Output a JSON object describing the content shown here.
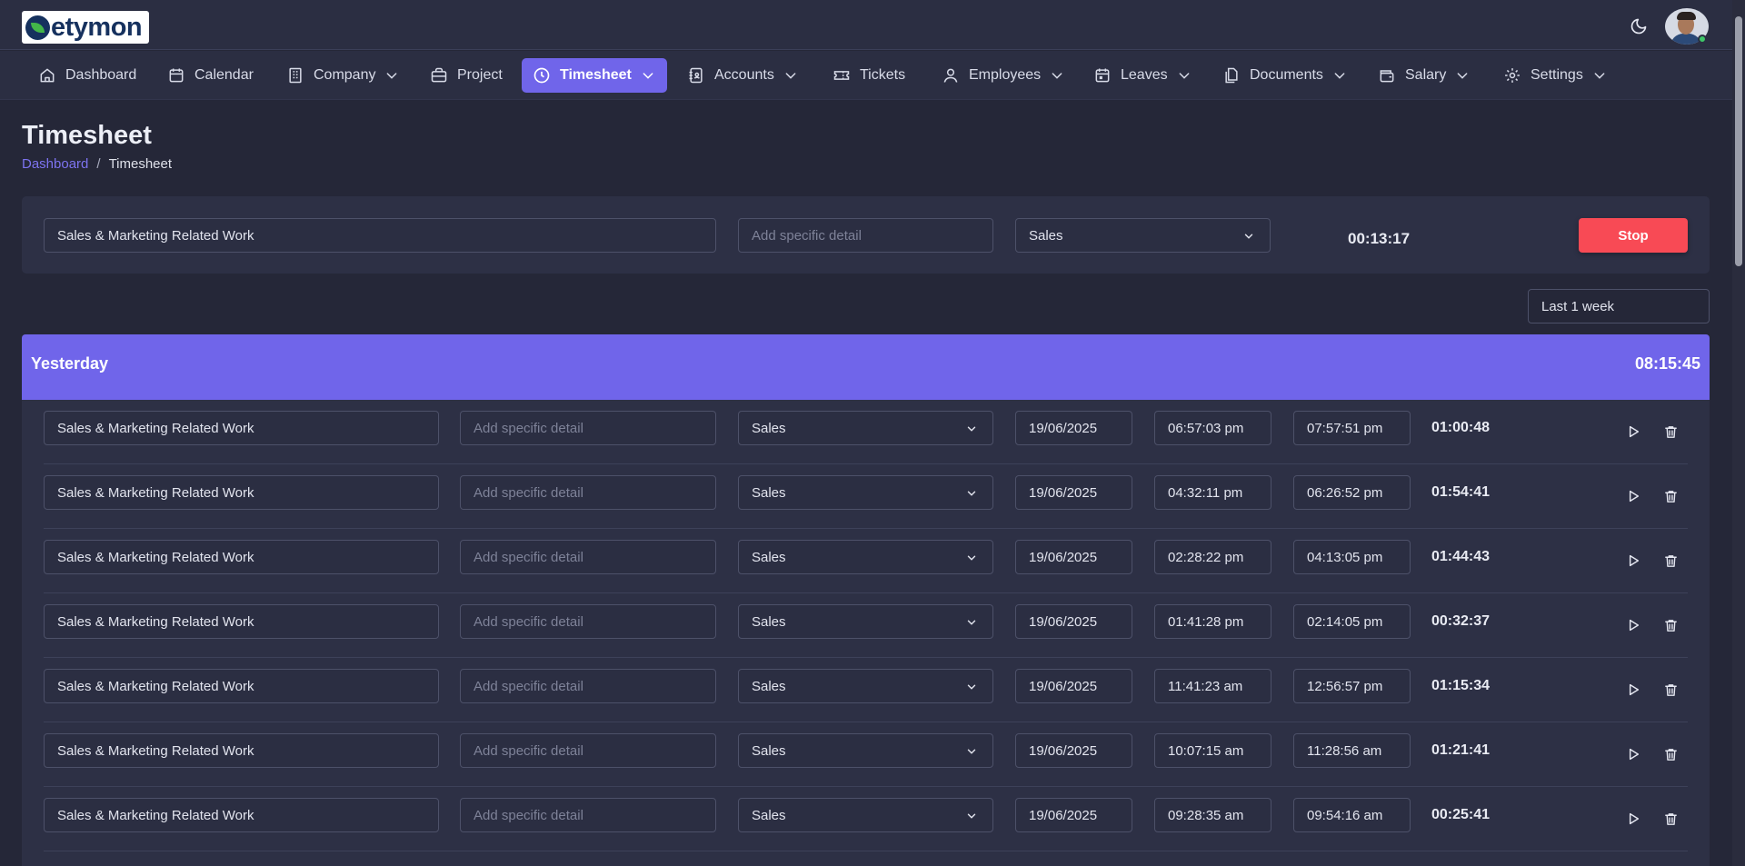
{
  "app": {
    "logo_text": "etymon"
  },
  "nav": {
    "items": [
      {
        "label": "Dashboard",
        "icon": "home-icon"
      },
      {
        "label": "Calendar",
        "icon": "calendar-icon"
      },
      {
        "label": "Company",
        "icon": "building-icon",
        "dropdown": true
      },
      {
        "label": "Project",
        "icon": "briefcase-icon"
      },
      {
        "label": "Timesheet",
        "icon": "clock-icon",
        "dropdown": true,
        "active": true
      },
      {
        "label": "Accounts",
        "icon": "ledger-icon",
        "dropdown": true
      },
      {
        "label": "Tickets",
        "icon": "ticket-icon"
      },
      {
        "label": "Employees",
        "icon": "user-icon",
        "dropdown": true
      },
      {
        "label": "Leaves",
        "icon": "calendar-grid-icon",
        "dropdown": true
      },
      {
        "label": "Documents",
        "icon": "documents-icon",
        "dropdown": true
      },
      {
        "label": "Salary",
        "icon": "wallet-icon",
        "dropdown": true
      },
      {
        "label": "Settings",
        "icon": "gear-icon",
        "dropdown": true
      }
    ]
  },
  "page": {
    "title": "Timesheet",
    "breadcrumb_link": "Dashboard",
    "breadcrumb_sep": "/",
    "breadcrumb_current": "Timesheet"
  },
  "timer": {
    "task": "Sales & Marketing Related Work",
    "detail_placeholder": "Add specific detail",
    "category": "Sales",
    "elapsed": "00:13:17",
    "stop_label": "Stop"
  },
  "filter": {
    "range": "Last 1 week"
  },
  "group": {
    "label": "Yesterday",
    "total": "08:15:45"
  },
  "entries": [
    {
      "task": "Sales & Marketing Related Work",
      "detail_placeholder": "Add specific detail",
      "category": "Sales",
      "date": "19/06/2025",
      "start": "06:57:03 pm",
      "end": "07:57:51 pm",
      "duration": "01:00:48"
    },
    {
      "task": "Sales & Marketing Related Work",
      "detail_placeholder": "Add specific detail",
      "category": "Sales",
      "date": "19/06/2025",
      "start": "04:32:11 pm",
      "end": "06:26:52 pm",
      "duration": "01:54:41"
    },
    {
      "task": "Sales & Marketing Related Work",
      "detail_placeholder": "Add specific detail",
      "category": "Sales",
      "date": "19/06/2025",
      "start": "02:28:22 pm",
      "end": "04:13:05 pm",
      "duration": "01:44:43"
    },
    {
      "task": "Sales & Marketing Related Work",
      "detail_placeholder": "Add specific detail",
      "category": "Sales",
      "date": "19/06/2025",
      "start": "01:41:28 pm",
      "end": "02:14:05 pm",
      "duration": "00:32:37"
    },
    {
      "task": "Sales & Marketing Related Work",
      "detail_placeholder": "Add specific detail",
      "category": "Sales",
      "date": "19/06/2025",
      "start": "11:41:23 am",
      "end": "12:56:57 pm",
      "duration": "01:15:34"
    },
    {
      "task": "Sales & Marketing Related Work",
      "detail_placeholder": "Add specific detail",
      "category": "Sales",
      "date": "19/06/2025",
      "start": "10:07:15 am",
      "end": "11:28:56 am",
      "duration": "01:21:41"
    },
    {
      "task": "Sales & Marketing Related Work",
      "detail_placeholder": "Add specific detail",
      "category": "Sales",
      "date": "19/06/2025",
      "start": "09:28:35 am",
      "end": "09:54:16 am",
      "duration": "00:25:41"
    }
  ],
  "colors": {
    "accent": "#7065ea",
    "stop": "#f84a55",
    "background": "#252738",
    "card": "#2d3045"
  }
}
